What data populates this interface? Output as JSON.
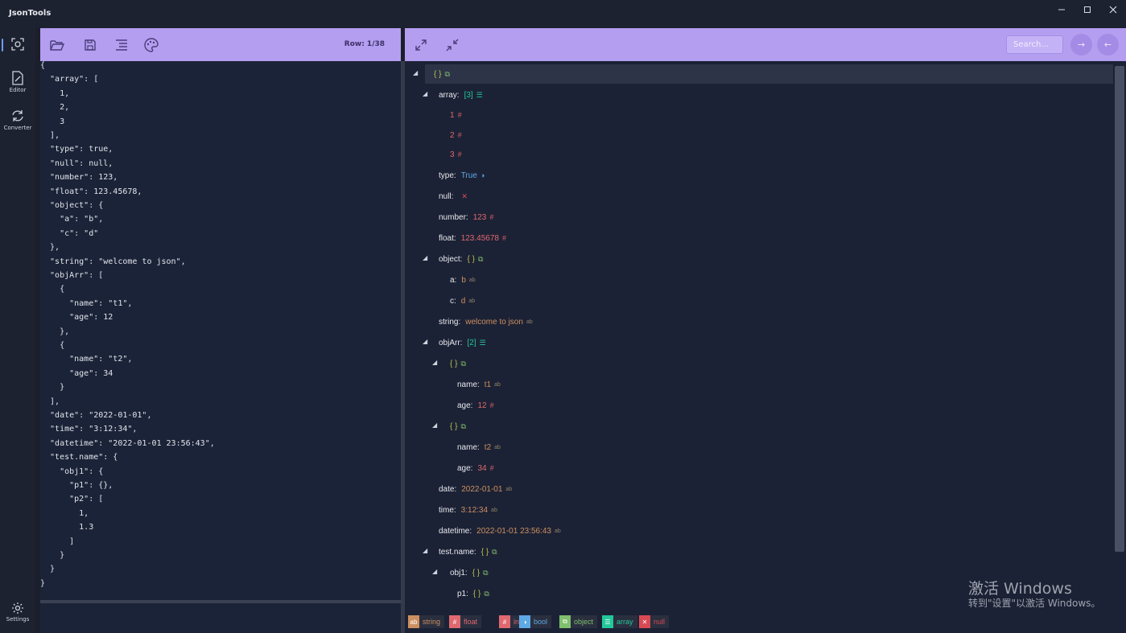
{
  "app": {
    "title": "JsonTools"
  },
  "sidebar": {
    "items": [
      {
        "label": "",
        "icon": "screenshot-icon"
      },
      {
        "label": "Editor",
        "icon": "editor-icon"
      },
      {
        "label": "Converter",
        "icon": "converter-icon"
      }
    ],
    "settings_label": "Settings"
  },
  "left_toolbar": {
    "row_indicator": "Row: 1/38"
  },
  "right_toolbar": {
    "search_placeholder": "Search..."
  },
  "editor": {
    "lines": [
      "{",
      "  \"array\": [",
      "    1,",
      "    2,",
      "    3",
      "  ],",
      "  \"type\": true,",
      "  \"null\": null,",
      "  \"number\": 123,",
      "  \"float\": 123.45678,",
      "  \"object\": {",
      "    \"a\": \"b\",",
      "    \"c\": \"d\"",
      "  },",
      "  \"string\": \"welcome to json\",",
      "  \"objArr\": [",
      "    {",
      "      \"name\": \"t1\",",
      "      \"age\": 12",
      "    },",
      "    {",
      "      \"name\": \"t2\",",
      "      \"age\": 34",
      "    }",
      "  ],",
      "  \"date\": \"2022-01-01\",",
      "  \"time\": \"3:12:34\",",
      "  \"datetime\": \"2022-01-01 23:56:43\",",
      "  \"test.name\": {",
      "    \"obj1\": {",
      "      \"p1\": {},",
      "      \"p2\": [",
      "        1,",
      "        1.3",
      "      ]",
      "    }",
      "  }",
      "}"
    ]
  },
  "tree": {
    "nodes": [
      {
        "key": "",
        "value": "{ }",
        "vtype": "obj",
        "caret": true,
        "depth": 0
      },
      {
        "key": "array:",
        "value": "[3]",
        "vtype": "arr",
        "caret": true,
        "depth": 1
      },
      {
        "key": "",
        "value": "1",
        "vtype": "num",
        "caret": false,
        "depth": 2
      },
      {
        "key": "",
        "value": "2",
        "vtype": "num",
        "caret": false,
        "depth": 2
      },
      {
        "key": "",
        "value": "3",
        "vtype": "num",
        "caret": false,
        "depth": 2
      },
      {
        "key": "type:",
        "value": "True",
        "vtype": "bool",
        "caret": false,
        "depth": 1
      },
      {
        "key": "null:",
        "value": "",
        "vtype": "null",
        "caret": false,
        "depth": 1
      },
      {
        "key": "number:",
        "value": "123",
        "vtype": "num",
        "caret": false,
        "depth": 1
      },
      {
        "key": "float:",
        "value": "123.45678",
        "vtype": "num",
        "caret": false,
        "depth": 1
      },
      {
        "key": "object:",
        "value": "{ }",
        "vtype": "obj",
        "caret": true,
        "depth": 1
      },
      {
        "key": "a:",
        "value": "b",
        "vtype": "str",
        "caret": false,
        "depth": 2
      },
      {
        "key": "c:",
        "value": "d",
        "vtype": "str",
        "caret": false,
        "depth": 2
      },
      {
        "key": "string:",
        "value": "welcome to json",
        "vtype": "str",
        "caret": false,
        "depth": 1
      },
      {
        "key": "objArr:",
        "value": "[2]",
        "vtype": "arr",
        "caret": true,
        "depth": 1
      },
      {
        "key": "",
        "value": "{ }",
        "vtype": "obj",
        "caret": true,
        "depth": 2
      },
      {
        "key": "name:",
        "value": "t1",
        "vtype": "str",
        "caret": false,
        "depth": 3
      },
      {
        "key": "age:",
        "value": "12",
        "vtype": "num",
        "caret": false,
        "depth": 3
      },
      {
        "key": "",
        "value": "{ }",
        "vtype": "obj",
        "caret": true,
        "depth": 2
      },
      {
        "key": "name:",
        "value": "t2",
        "vtype": "str",
        "caret": false,
        "depth": 3
      },
      {
        "key": "age:",
        "value": "34",
        "vtype": "num",
        "caret": false,
        "depth": 3
      },
      {
        "key": "date:",
        "value": "2022-01-01",
        "vtype": "str",
        "caret": false,
        "depth": 1
      },
      {
        "key": "time:",
        "value": "3:12:34",
        "vtype": "str",
        "caret": false,
        "depth": 1
      },
      {
        "key": "datetime:",
        "value": "2022-01-01 23:56:43",
        "vtype": "str",
        "caret": false,
        "depth": 1
      },
      {
        "key": "test.name:",
        "value": "{ }",
        "vtype": "obj",
        "caret": true,
        "depth": 1
      },
      {
        "key": "obj1:",
        "value": "{ }",
        "vtype": "obj",
        "caret": true,
        "depth": 2
      },
      {
        "key": "p1:",
        "value": "{ }",
        "vtype": "obj",
        "caret": false,
        "depth": 3
      }
    ]
  },
  "legend": [
    {
      "label": "string",
      "icon": "ab",
      "vtype": "str",
      "color": "#cc8f60"
    },
    {
      "label": "float",
      "icon": "#",
      "vtype": "num",
      "color": "#e0686f"
    },
    {
      "label": "int",
      "icon": "#",
      "vtype": "num",
      "color": "#e0686f"
    },
    {
      "label": "bool",
      "icon": "◑",
      "vtype": "bool",
      "color": "#5fa9e6"
    },
    {
      "label": "object",
      "icon": "⧉",
      "vtype": "obj",
      "color": "#7fbf6e"
    },
    {
      "label": "array",
      "icon": "☰",
      "vtype": "arr",
      "color": "#23c79a"
    },
    {
      "label": "null",
      "icon": "✕",
      "vtype": "null",
      "color": "#d84a52"
    }
  ],
  "watermark": {
    "line1": "激活 Windows",
    "line2": "转到\"设置\"以激活 Windows。"
  }
}
